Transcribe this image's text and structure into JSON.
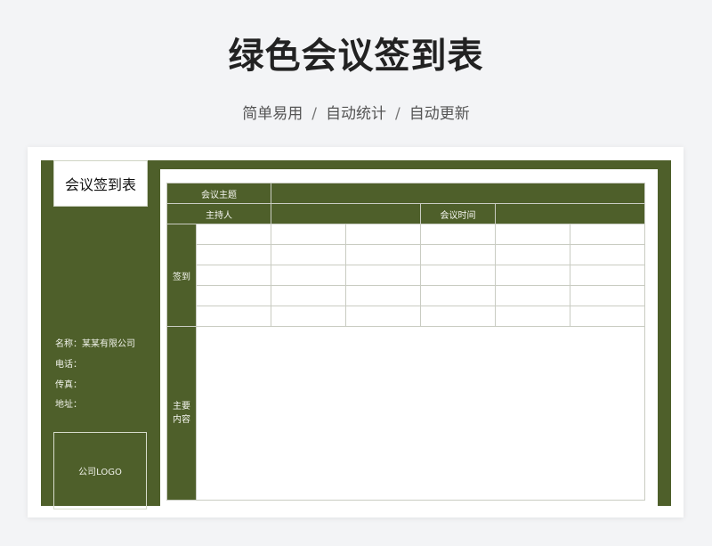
{
  "page": {
    "title": "绿色会议签到表",
    "subtitle": [
      "简单易用",
      "自动统计",
      "自动更新"
    ],
    "separator": "/"
  },
  "sheet": {
    "label": "会议签到表",
    "company": {
      "name_label": "名称：",
      "name_value": "某某有限公司",
      "phone_label": "电话：",
      "fax_label": "传真：",
      "address_label": "地址："
    },
    "logo_text": "公司LOGO",
    "table": {
      "topic_label": "会议主题",
      "host_label": "主持人",
      "time_label": "会议时间",
      "signin_label": "签到",
      "content_label_line1": "主要",
      "content_label_line2": "内容"
    }
  },
  "colors": {
    "sheet_green": "#4e5f2a",
    "page_bg": "#f3f4f6"
  }
}
